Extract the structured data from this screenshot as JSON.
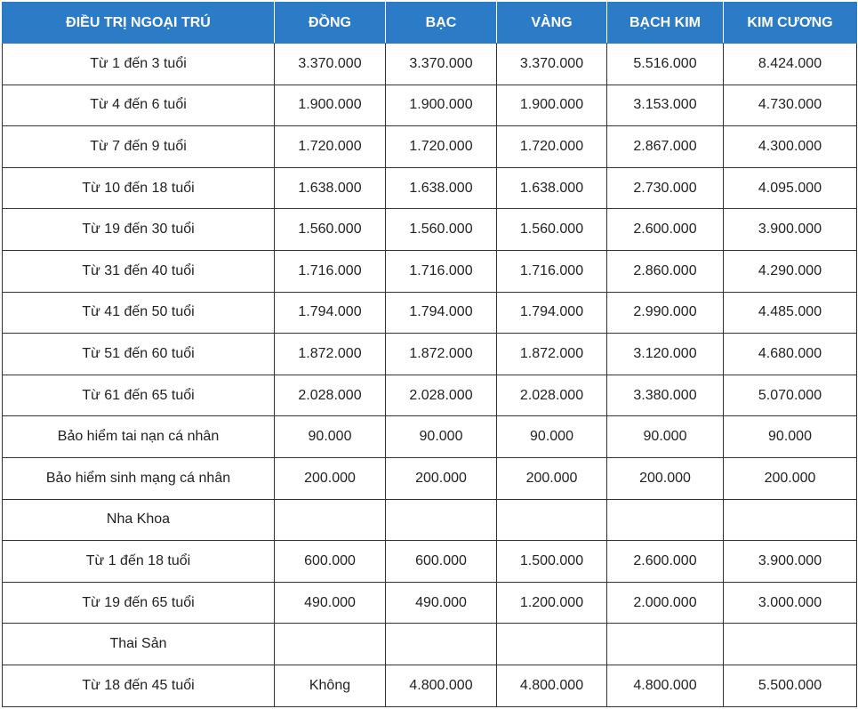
{
  "headers": [
    "ĐIỀU TRỊ NGOẠI TRÚ",
    "ĐỒNG",
    "BẠC",
    "VÀNG",
    "BẠCH KIM",
    "KIM CƯƠNG"
  ],
  "rows": [
    [
      "Từ 1 đến 3 tuổi",
      "3.370.000",
      "3.370.000",
      "3.370.000",
      "5.516.000",
      "8.424.000"
    ],
    [
      "Từ 4 đến 6 tuổi",
      "1.900.000",
      "1.900.000",
      "1.900.000",
      "3.153.000",
      "4.730.000"
    ],
    [
      "Từ 7 đến 9 tuổi",
      "1.720.000",
      "1.720.000",
      "1.720.000",
      "2.867.000",
      "4.300.000"
    ],
    [
      "Từ 10 đến 18 tuổi",
      "1.638.000",
      "1.638.000",
      "1.638.000",
      "2.730.000",
      "4.095.000"
    ],
    [
      "Từ 19 đến 30 tuổi",
      "1.560.000",
      "1.560.000",
      "1.560.000",
      "2.600.000",
      "3.900.000"
    ],
    [
      "Từ 31 đến 40 tuổi",
      "1.716.000",
      "1.716.000",
      "1.716.000",
      "2.860.000",
      "4.290.000"
    ],
    [
      "Từ 41 đến 50 tuổi",
      "1.794.000",
      "1.794.000",
      "1.794.000",
      "2.990.000",
      "4.485.000"
    ],
    [
      "Từ 51 đến 60 tuổi",
      "1.872.000",
      "1.872.000",
      "1.872.000",
      "3.120.000",
      "4.680.000"
    ],
    [
      "Từ 61 đến 65 tuổi",
      "2.028.000",
      "2.028.000",
      "2.028.000",
      "3.380.000",
      "5.070.000"
    ],
    [
      "Bảo hiểm tai nạn cá nhân",
      "90.000",
      "90.000",
      "90.000",
      "90.000",
      "90.000"
    ],
    [
      "Bảo hiểm sinh mạng cá nhân",
      "200.000",
      "200.000",
      "200.000",
      "200.000",
      "200.000"
    ],
    [
      "Nha Khoa",
      "",
      "",
      "",
      "",
      ""
    ],
    [
      "Từ 1 đến 18 tuổi",
      "600.000",
      "600.000",
      "1.500.000",
      "2.600.000",
      "3.900.000"
    ],
    [
      "Từ 19 đến 65 tuổi",
      "490.000",
      "490.000",
      "1.200.000",
      "2.000.000",
      "3.000.000"
    ],
    [
      "Thai Sản",
      "",
      "",
      "",
      "",
      ""
    ],
    [
      "Từ 18 đến 45 tuổi",
      "Không",
      "4.800.000",
      "4.800.000",
      "4.800.000",
      "5.500.000"
    ]
  ],
  "colors": {
    "header_bg": "#2b7bc7",
    "header_text": "#ffffff",
    "border": "#333333"
  }
}
